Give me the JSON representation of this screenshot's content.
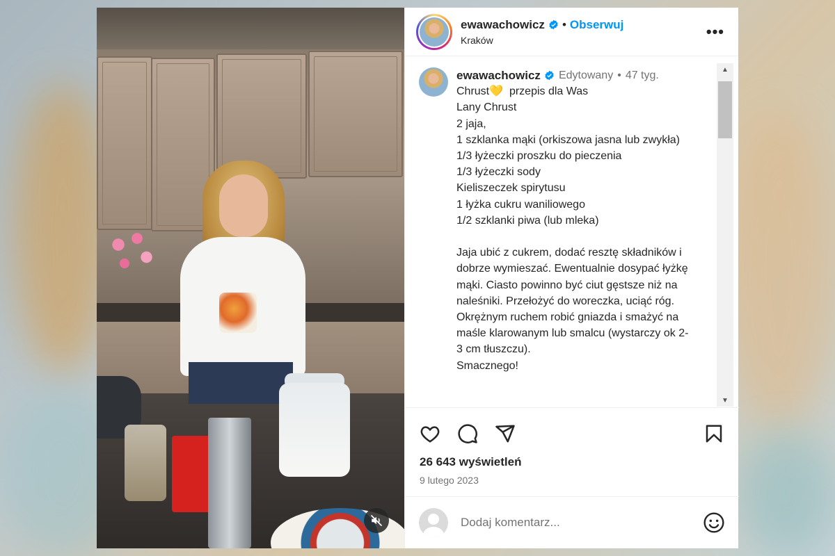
{
  "header": {
    "username": "ewawachowicz",
    "separator": "•",
    "follow_label": "Obserwuj",
    "location": "Kraków",
    "more_label": "•••"
  },
  "caption": {
    "username": "ewawachowicz",
    "edited": "Edytowany",
    "dot": "•",
    "age": "47 tyg.",
    "lines": [
      "Chrust💛  przepis dla Was",
      "Lany Chrust",
      "2 jaja,",
      "1 szklanka mąki (orkiszowa jasna lub zwykła)",
      "1/3 łyżeczki proszku do pieczenia",
      "1/3 łyżeczki sody",
      "Kieliszeczek spirytusu",
      "1 łyżka cukru waniliowego",
      "1/2 szklanki piwa (lub mleka)",
      "",
      "Jaja ubić z cukrem, dodać resztę składników i dobrze wymieszać. Ewentualnie dosypać łyżkę mąki. Ciasto powinno być ciut gęstsze niż na naleśniki. Przełożyć do woreczka, uciąć róg. Okrężnym ruchem robić gniazda i smażyć na maśle klarowanym lub smalcu (wystarczy ok 2-3 cm tłuszczu).",
      "Smacznego!"
    ]
  },
  "stats": {
    "views": "26 643 wyświetleń",
    "date": "9 lutego 2023"
  },
  "comment": {
    "placeholder": "Dodaj komentarz..."
  },
  "icons": {
    "verified": "verified-badge-icon",
    "like": "heart-icon",
    "comment": "comment-bubble-icon",
    "share": "paper-plane-icon",
    "save": "bookmark-icon",
    "emoji": "smiley-icon",
    "mute": "muted-speaker-icon"
  },
  "colors": {
    "accent": "#0095f6",
    "text": "#262626",
    "secondary": "#737373"
  }
}
